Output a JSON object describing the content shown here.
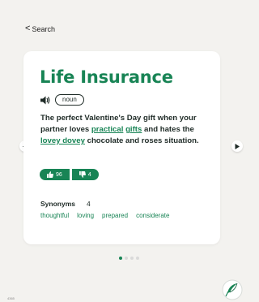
{
  "nav": {
    "back_label": "Search"
  },
  "word": {
    "title": "Life Insurance",
    "part_of_speech": "noun",
    "definition": {
      "s1": "The perfect Valentine's Day gift when your partner loves ",
      "link1": "practical",
      "s2": " ",
      "link2": "gifts",
      "s3": " and hates the ",
      "link3": "lovey dovey",
      "s4": " chocolate and roses situation."
    }
  },
  "votes": {
    "up": "96",
    "down": "4"
  },
  "synonyms": {
    "label": "Synonyms",
    "count": "4",
    "items": [
      "thoughtful",
      "loving",
      "prepared",
      "considerate"
    ]
  },
  "pagination": {
    "total": 4,
    "current": 1
  },
  "footer": {
    "tag": "4365"
  },
  "colors": {
    "accent": "#188455",
    "background": "#f3f2ef",
    "card": "#ffffff"
  },
  "icons": {
    "back": "chevron-left-icon",
    "speaker": "speaker-icon",
    "thumbs_up": "thumbs-up-icon",
    "thumbs_down": "thumbs-down-icon",
    "prev": "arrow-left-icon",
    "next": "arrow-right-icon",
    "logo": "feather-logo-icon"
  }
}
